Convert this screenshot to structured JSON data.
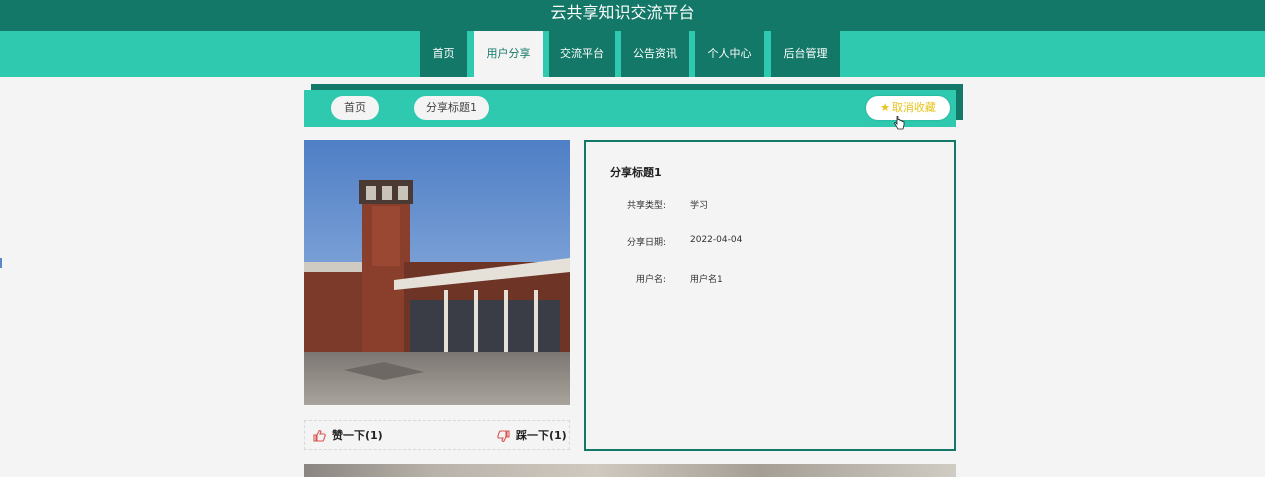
{
  "site": {
    "title": "云共享知识交流平台"
  },
  "nav": {
    "items": [
      {
        "label": "首页"
      },
      {
        "label": "用户分享"
      },
      {
        "label": "交流平台"
      },
      {
        "label": "公告资讯"
      },
      {
        "label": "个人中心"
      },
      {
        "label": "后台管理"
      }
    ],
    "active_index": 1
  },
  "breadcrumb": {
    "home_label": "首页",
    "current_label": "分享标题1",
    "favorite_label": "取消收藏"
  },
  "votes": {
    "like_label": "赞一下(1)",
    "dislike_label": "踩一下(1)"
  },
  "detail": {
    "title": "分享标题1",
    "fields": [
      {
        "label": "共享类型:",
        "value": "学习"
      },
      {
        "label": "分享日期:",
        "value": "2022-04-04"
      },
      {
        "label": "用户名:",
        "value": "用户名1"
      }
    ]
  },
  "colors": {
    "primary_dark": "#137867",
    "primary": "#2ec9ae",
    "star": "#e8c21a",
    "vote_icon": "#d9534f"
  }
}
